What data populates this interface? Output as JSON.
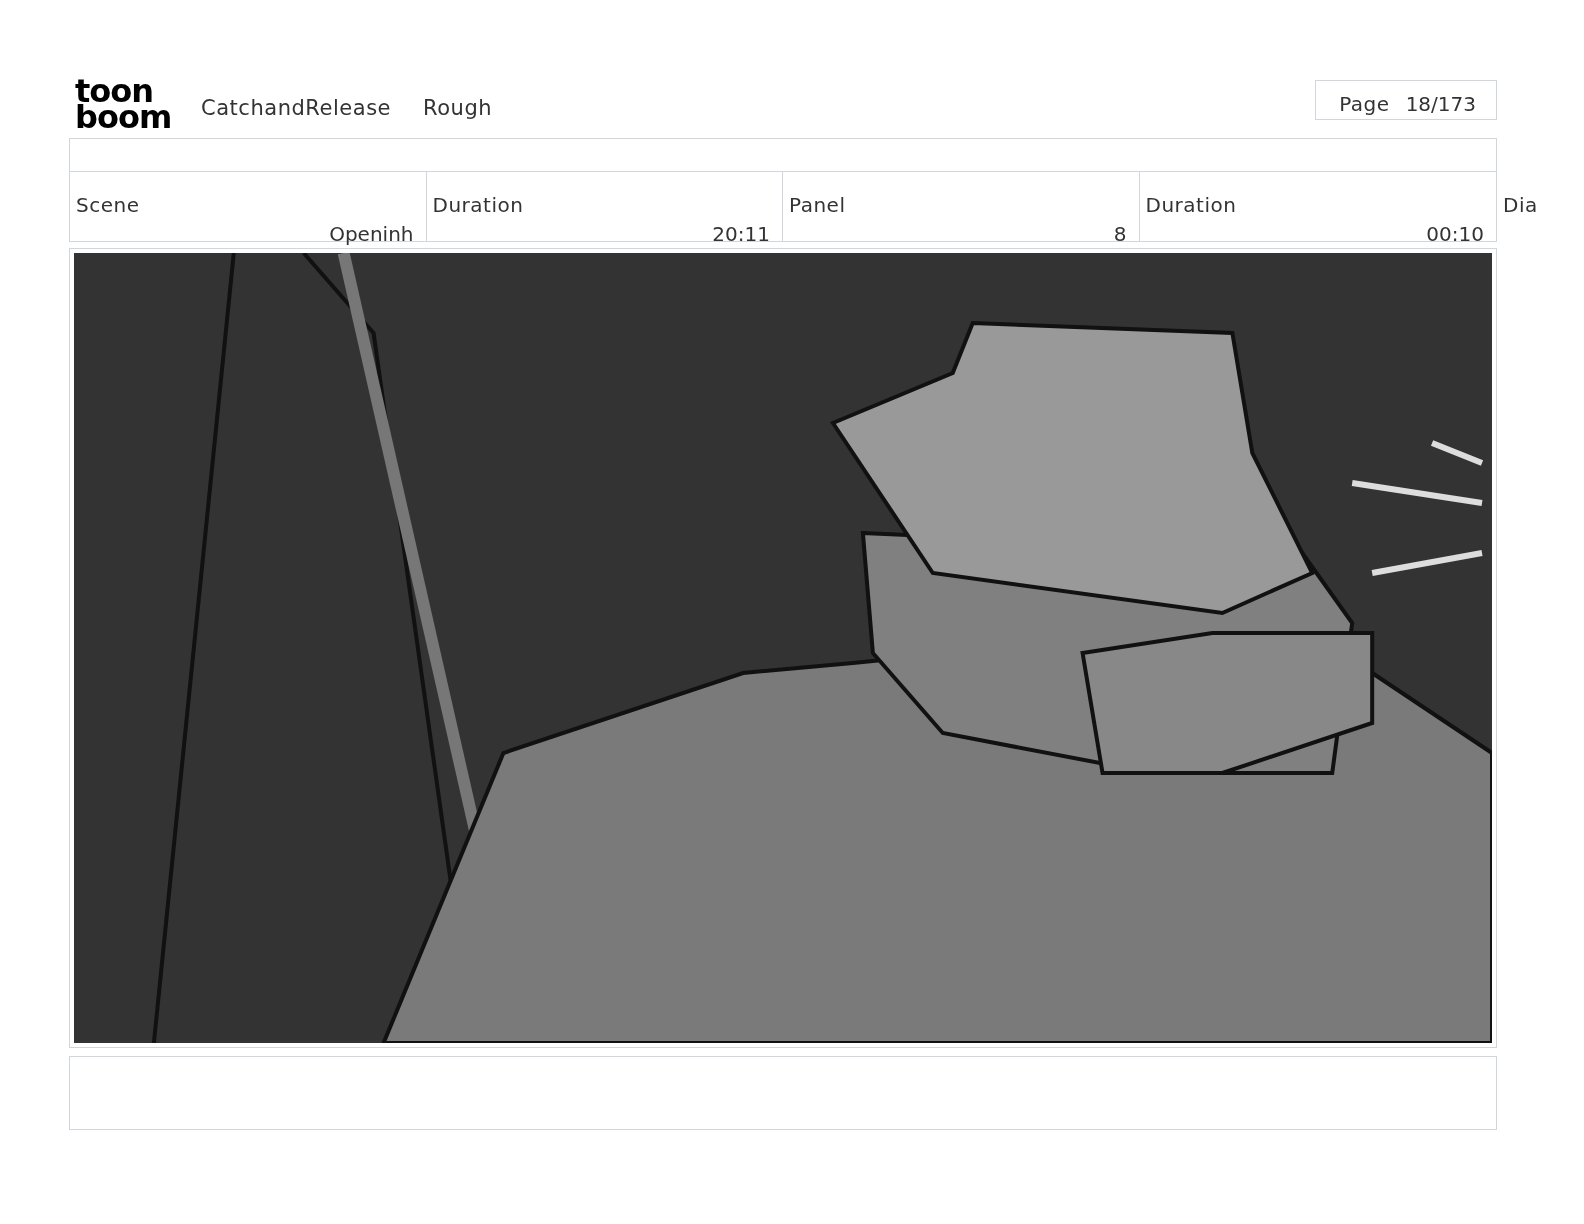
{
  "header": {
    "logo": [
      "toon",
      "boom"
    ],
    "project": "CatchandRelease",
    "stage": "Rough",
    "page_label": "Page",
    "page_number": "18/173"
  },
  "fields": [
    {
      "label": "Scene",
      "value": "Openinh"
    },
    {
      "label": "Duration",
      "value": "20:11"
    },
    {
      "label": "Panel",
      "value": "8"
    },
    {
      "label": "Duration",
      "value": "00:10"
    }
  ],
  "overflow_label": "Dia"
}
